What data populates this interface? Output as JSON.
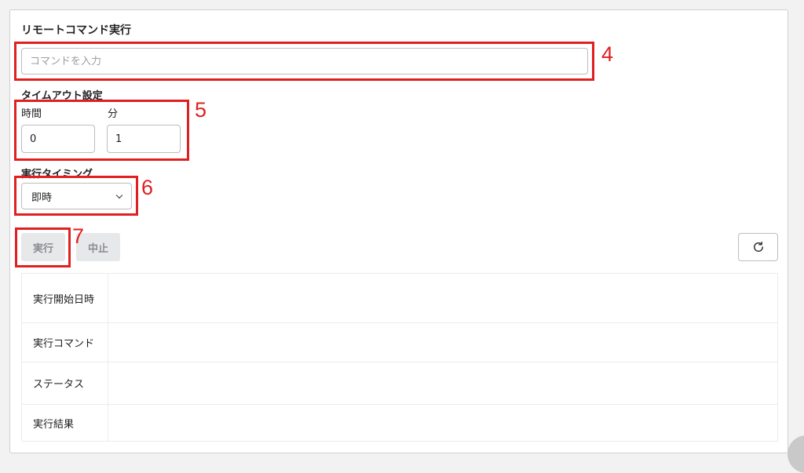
{
  "remote_command": {
    "title": "リモートコマンド実行",
    "input_placeholder": "コマンドを入力",
    "input_value": ""
  },
  "timeout": {
    "title": "タイムアウト設定",
    "hours_label": "時間",
    "hours_value": "0",
    "minutes_label": "分",
    "minutes_value": "1"
  },
  "timing": {
    "title": "実行タイミング",
    "selected": "即時"
  },
  "buttons": {
    "execute": "実行",
    "stop": "中止"
  },
  "result_rows": [
    {
      "label": "実行開始日時",
      "value": ""
    },
    {
      "label": "実行コマンド",
      "value": ""
    },
    {
      "label": "ステータス",
      "value": ""
    },
    {
      "label": "実行結果",
      "value": ""
    }
  ],
  "annotations": {
    "n4": "4",
    "n5": "5",
    "n6": "6",
    "n7": "7",
    "color": "#e02020"
  },
  "icons": {
    "refresh": "refresh-icon",
    "chevron": "chevron-down-icon"
  }
}
